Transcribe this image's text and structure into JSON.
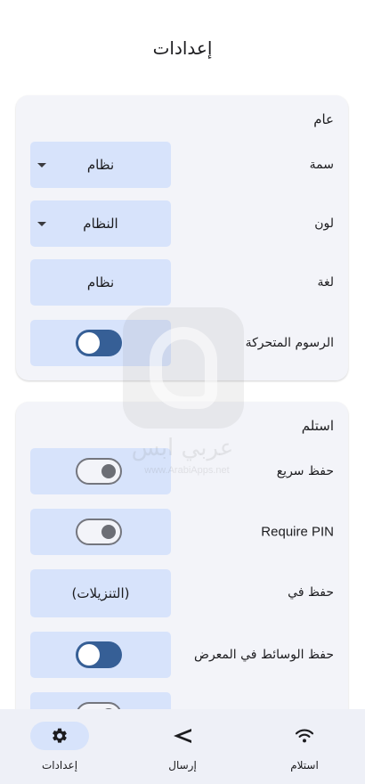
{
  "header": {
    "title": "إعدادات"
  },
  "general": {
    "title": "عام",
    "theme": {
      "label": "سمة",
      "value": "نظام"
    },
    "color": {
      "label": "لون",
      "value": "النظام"
    },
    "language": {
      "label": "لغة",
      "value": "نظام"
    },
    "animations": {
      "label": "الرسوم المتحركة",
      "enabled": true
    }
  },
  "receive": {
    "title": "استلم",
    "quick_save": {
      "label": "حفظ سريع",
      "enabled": false
    },
    "require_pin": {
      "label": "Require PIN",
      "enabled": false
    },
    "save_to": {
      "label": "حفظ في",
      "value": "(التنزيلات)"
    },
    "save_media_gallery": {
      "label": "حفظ الوسائط في المعرض",
      "enabled": true
    },
    "partial_row": {
      "enabled": false
    }
  },
  "watermark": {
    "text": "عربي ابس",
    "sub": "www.ArabiApps.net"
  },
  "nav": {
    "items": [
      {
        "label": "إعدادات",
        "icon": "gear-icon",
        "active": true
      },
      {
        "label": "إرسال",
        "icon": "send-icon",
        "active": false
      },
      {
        "label": "استلام",
        "icon": "wifi-icon",
        "active": false
      }
    ]
  },
  "colors": {
    "accent": "#365f96",
    "control_bg": "#d7e3fb",
    "card_bg": "#f3f4f9",
    "nav_bg": "#eef0f7"
  }
}
